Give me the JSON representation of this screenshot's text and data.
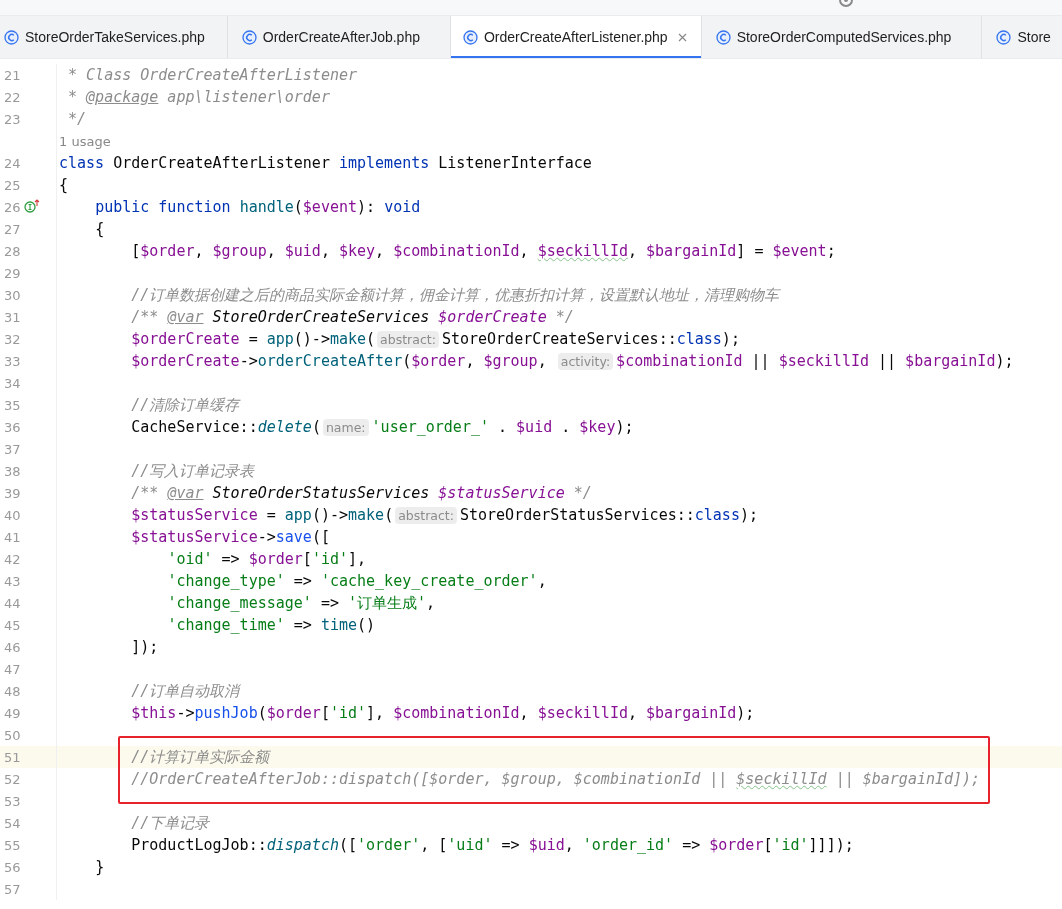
{
  "tabs": [
    {
      "label": "StoreOrderTakeServices.php",
      "selected": false
    },
    {
      "label": "OrderCreateAfterJob.php",
      "selected": false
    },
    {
      "label": "OrderCreateAfterListener.php",
      "selected": true
    },
    {
      "label": "StoreOrderComputedServices.php",
      "selected": false
    },
    {
      "label": "Store",
      "selected": false
    }
  ],
  "lines": [
    {
      "kind": "code",
      "number": "21",
      "current": false,
      "boxed": false,
      "tokens": [
        {
          "t": " * Class OrderCreateAfterListener",
          "kind": "doc"
        }
      ]
    },
    {
      "kind": "code",
      "number": "22",
      "current": false,
      "boxed": false,
      "tokens": [
        {
          "t": " * ",
          "kind": "doc"
        },
        {
          "t": "@package",
          "kind": "doctag"
        },
        {
          "t": " app\\listener\\order",
          "kind": "doc"
        }
      ]
    },
    {
      "kind": "code",
      "number": "23",
      "current": false,
      "boxed": false,
      "tokens": [
        {
          "t": " */",
          "kind": "doc"
        }
      ]
    },
    {
      "kind": "usage",
      "text": "1 usage",
      "current": false,
      "boxed": false
    },
    {
      "kind": "code",
      "number": "24",
      "current": false,
      "boxed": false,
      "tokens": [
        {
          "t": "class",
          "kind": "kw"
        },
        {
          "t": " OrderCreateAfterListener ",
          "kind": "plain"
        },
        {
          "t": "implements",
          "kind": "kw"
        },
        {
          "t": " ListenerInterface",
          "kind": "plain"
        }
      ]
    },
    {
      "kind": "code",
      "number": "25",
      "current": false,
      "boxed": false,
      "tokens": [
        {
          "t": "{",
          "kind": "plain"
        }
      ]
    },
    {
      "kind": "code",
      "number": "26",
      "current": false,
      "boxed": false,
      "gutter_mark": {
        "kind": "implements"
      },
      "tokens": [
        {
          "t": "    public function ",
          "kind": "kw"
        },
        {
          "t": "handle",
          "kind": "fn"
        },
        {
          "t": "(",
          "kind": "plain"
        },
        {
          "t": "$event",
          "kind": "var"
        },
        {
          "t": "): ",
          "kind": "plain"
        },
        {
          "t": "void",
          "kind": "kw"
        }
      ]
    },
    {
      "kind": "code",
      "number": "27",
      "current": false,
      "boxed": false,
      "tokens": [
        {
          "t": "    {",
          "kind": "plain"
        }
      ]
    },
    {
      "kind": "code",
      "number": "28",
      "current": false,
      "boxed": false,
      "tokens": [
        {
          "t": "        [",
          "kind": "plain"
        },
        {
          "t": "$order",
          "kind": "var"
        },
        {
          "t": ", ",
          "kind": "plain"
        },
        {
          "t": "$group",
          "kind": "var"
        },
        {
          "t": ", ",
          "kind": "plain"
        },
        {
          "t": "$uid",
          "kind": "var"
        },
        {
          "t": ", ",
          "kind": "plain"
        },
        {
          "t": "$key",
          "kind": "var"
        },
        {
          "t": ", ",
          "kind": "plain"
        },
        {
          "t": "$combinationId",
          "kind": "var"
        },
        {
          "t": ", ",
          "kind": "plain"
        },
        {
          "t": "$seckillId",
          "kind": "vartypo"
        },
        {
          "t": ", ",
          "kind": "plain"
        },
        {
          "t": "$bargainId",
          "kind": "var"
        },
        {
          "t": "] = ",
          "kind": "plain"
        },
        {
          "t": "$event",
          "kind": "var"
        },
        {
          "t": ";",
          "kind": "plain"
        }
      ]
    },
    {
      "kind": "code",
      "number": "29",
      "current": false,
      "boxed": false
    },
    {
      "kind": "code",
      "number": "30",
      "current": false,
      "boxed": false,
      "tokens": [
        {
          "t": "        //订单数据创建之后的商品实际金额计算，佣金计算，优惠折扣计算，设置默认地址，清理购物车",
          "kind": "cmt"
        }
      ]
    },
    {
      "kind": "code",
      "number": "31",
      "current": false,
      "boxed": false,
      "tokens": [
        {
          "t": "        /** ",
          "kind": "doc"
        },
        {
          "t": "@var",
          "kind": "doctag"
        },
        {
          "t": " StoreOrderCreateServices ",
          "kind": "doctype"
        },
        {
          "t": "$orderCreate",
          "kind": "docvar"
        },
        {
          "t": " */",
          "kind": "doc"
        }
      ]
    },
    {
      "kind": "code",
      "number": "32",
      "current": false,
      "boxed": false,
      "tokens": [
        {
          "t": "        $orderCreate",
          "kind": "var"
        },
        {
          "t": " = ",
          "kind": "plain"
        },
        {
          "t": "app",
          "kind": "fn"
        },
        {
          "t": "()->",
          "kind": "plain"
        },
        {
          "t": "make",
          "kind": "fn"
        },
        {
          "t": "(",
          "kind": "plain"
        },
        {
          "t": "abstract:",
          "kind": "hint"
        },
        {
          "t": "StoreOrderCreateServices::",
          "kind": "plain"
        },
        {
          "t": "class",
          "kind": "kw"
        },
        {
          "t": ");",
          "kind": "plain"
        }
      ]
    },
    {
      "kind": "code",
      "number": "33",
      "current": false,
      "boxed": false,
      "tokens": [
        {
          "t": "        $orderCreate",
          "kind": "var"
        },
        {
          "t": "->",
          "kind": "plain"
        },
        {
          "t": "orderCreateAfter",
          "kind": "fn"
        },
        {
          "t": "(",
          "kind": "plain"
        },
        {
          "t": "$order",
          "kind": "var"
        },
        {
          "t": ", ",
          "kind": "plain"
        },
        {
          "t": "$group",
          "kind": "var"
        },
        {
          "t": ", ",
          "kind": "plain"
        },
        {
          "t": "activity:",
          "kind": "hint"
        },
        {
          "t": "$combinationId",
          "kind": "var"
        },
        {
          "t": " || ",
          "kind": "plain"
        },
        {
          "t": "$seckillId",
          "kind": "var"
        },
        {
          "t": " || ",
          "kind": "plain"
        },
        {
          "t": "$bargainId",
          "kind": "var"
        },
        {
          "t": ");",
          "kind": "plain"
        }
      ]
    },
    {
      "kind": "code",
      "number": "34",
      "current": false,
      "boxed": false
    },
    {
      "kind": "code",
      "number": "35",
      "current": false,
      "boxed": false,
      "tokens": [
        {
          "t": "        //清除订单缓存",
          "kind": "cmt"
        }
      ]
    },
    {
      "kind": "code",
      "number": "36",
      "current": false,
      "boxed": false,
      "tokens": [
        {
          "t": "        CacheService::",
          "kind": "plain"
        },
        {
          "t": "delete",
          "kind": "fni"
        },
        {
          "t": "(",
          "kind": "plain"
        },
        {
          "t": "name:",
          "kind": "hint"
        },
        {
          "t": "'user_order_'",
          "kind": "str"
        },
        {
          "t": " . ",
          "kind": "plain"
        },
        {
          "t": "$uid",
          "kind": "var"
        },
        {
          "t": " . ",
          "kind": "plain"
        },
        {
          "t": "$key",
          "kind": "var"
        },
        {
          "t": ");",
          "kind": "plain"
        }
      ]
    },
    {
      "kind": "code",
      "number": "37",
      "current": false,
      "boxed": false
    },
    {
      "kind": "code",
      "number": "38",
      "current": false,
      "boxed": false,
      "tokens": [
        {
          "t": "        //写入订单记录表",
          "kind": "cmt"
        }
      ]
    },
    {
      "kind": "code",
      "number": "39",
      "current": false,
      "boxed": false,
      "tokens": [
        {
          "t": "        /** ",
          "kind": "doc"
        },
        {
          "t": "@var",
          "kind": "doctag"
        },
        {
          "t": " StoreOrderStatusServices ",
          "kind": "doctype"
        },
        {
          "t": "$statusService",
          "kind": "docvar"
        },
        {
          "t": " */",
          "kind": "doc"
        }
      ]
    },
    {
      "kind": "code",
      "number": "40",
      "current": false,
      "boxed": false,
      "tokens": [
        {
          "t": "        $statusService",
          "kind": "var"
        },
        {
          "t": " = ",
          "kind": "plain"
        },
        {
          "t": "app",
          "kind": "fn"
        },
        {
          "t": "()->",
          "kind": "plain"
        },
        {
          "t": "make",
          "kind": "fn"
        },
        {
          "t": "(",
          "kind": "plain"
        },
        {
          "t": "abstract:",
          "kind": "hint"
        },
        {
          "t": "StoreOrderStatusServices::",
          "kind": "plain"
        },
        {
          "t": "class",
          "kind": "kw"
        },
        {
          "t": ");",
          "kind": "plain"
        }
      ]
    },
    {
      "kind": "code",
      "number": "41",
      "current": false,
      "boxed": false,
      "tokens": [
        {
          "t": "        $statusService",
          "kind": "var"
        },
        {
          "t": "->",
          "kind": "plain"
        },
        {
          "t": "save",
          "kind": "method"
        },
        {
          "t": "([",
          "kind": "plain"
        }
      ]
    },
    {
      "kind": "code",
      "number": "42",
      "current": false,
      "boxed": false,
      "tokens": [
        {
          "t": "            'oid'",
          "kind": "str"
        },
        {
          "t": " => ",
          "kind": "plain"
        },
        {
          "t": "$order",
          "kind": "var"
        },
        {
          "t": "[",
          "kind": "plain"
        },
        {
          "t": "'id'",
          "kind": "str"
        },
        {
          "t": "],",
          "kind": "plain"
        }
      ]
    },
    {
      "kind": "code",
      "number": "43",
      "current": false,
      "boxed": false,
      "tokens": [
        {
          "t": "            'change_type'",
          "kind": "str"
        },
        {
          "t": " => ",
          "kind": "plain"
        },
        {
          "t": "'cache_key_create_order'",
          "kind": "str"
        },
        {
          "t": ",",
          "kind": "plain"
        }
      ]
    },
    {
      "kind": "code",
      "number": "44",
      "current": false,
      "boxed": false,
      "tokens": [
        {
          "t": "            'change_message'",
          "kind": "str"
        },
        {
          "t": " => ",
          "kind": "plain"
        },
        {
          "t": "'订单生成'",
          "kind": "str"
        },
        {
          "t": ",",
          "kind": "plain"
        }
      ]
    },
    {
      "kind": "code",
      "number": "45",
      "current": false,
      "boxed": false,
      "tokens": [
        {
          "t": "            'change_time'",
          "kind": "str"
        },
        {
          "t": " => ",
          "kind": "plain"
        },
        {
          "t": "time",
          "kind": "fn"
        },
        {
          "t": "()",
          "kind": "plain"
        }
      ]
    },
    {
      "kind": "code",
      "number": "46",
      "current": false,
      "boxed": false,
      "tokens": [
        {
          "t": "        ]);",
          "kind": "plain"
        }
      ]
    },
    {
      "kind": "code",
      "number": "47",
      "current": false,
      "boxed": false
    },
    {
      "kind": "code",
      "number": "48",
      "current": false,
      "boxed": false,
      "tokens": [
        {
          "t": "        //订单自动取消",
          "kind": "cmt"
        }
      ]
    },
    {
      "kind": "code",
      "number": "49",
      "current": false,
      "boxed": false,
      "tokens": [
        {
          "t": "        $this",
          "kind": "var"
        },
        {
          "t": "->",
          "kind": "plain"
        },
        {
          "t": "pushJob",
          "kind": "method"
        },
        {
          "t": "(",
          "kind": "plain"
        },
        {
          "t": "$order",
          "kind": "var"
        },
        {
          "t": "[",
          "kind": "plain"
        },
        {
          "t": "'id'",
          "kind": "str"
        },
        {
          "t": "], ",
          "kind": "plain"
        },
        {
          "t": "$combinationId",
          "kind": "var"
        },
        {
          "t": ", ",
          "kind": "plain"
        },
        {
          "t": "$seckillId",
          "kind": "var"
        },
        {
          "t": ", ",
          "kind": "plain"
        },
        {
          "t": "$bargainId",
          "kind": "var"
        },
        {
          "t": ");",
          "kind": "plain"
        }
      ]
    },
    {
      "kind": "code",
      "number": "50",
      "current": false,
      "boxed": false
    },
    {
      "kind": "code",
      "number": "51",
      "current": true,
      "boxed": true,
      "tokens": [
        {
          "t": "        //计算订单实际金额",
          "kind": "cmt"
        }
      ]
    },
    {
      "kind": "code",
      "number": "52",
      "current": false,
      "boxed": true,
      "tokens": [
        {
          "t": "        //OrderCreateAfterJob::dispatch([$order, $group, $combinationId || ",
          "kind": "cmt"
        },
        {
          "t": "$seckillId",
          "kind": "cmttypo"
        },
        {
          "t": " || $bargainId]);",
          "kind": "cmt"
        }
      ]
    },
    {
      "kind": "code",
      "number": "53",
      "current": false,
      "boxed": false
    },
    {
      "kind": "code",
      "number": "54",
      "current": false,
      "boxed": false,
      "tokens": [
        {
          "t": "        //下单记录",
          "kind": "cmt"
        }
      ]
    },
    {
      "kind": "code",
      "number": "55",
      "current": false,
      "boxed": false,
      "tokens": [
        {
          "t": "        ProductLogJob::",
          "kind": "plain"
        },
        {
          "t": "dispatch",
          "kind": "fni"
        },
        {
          "t": "([",
          "kind": "plain"
        },
        {
          "t": "'order'",
          "kind": "str"
        },
        {
          "t": ", [",
          "kind": "plain"
        },
        {
          "t": "'uid'",
          "kind": "str"
        },
        {
          "t": " => ",
          "kind": "plain"
        },
        {
          "t": "$uid",
          "kind": "var"
        },
        {
          "t": ", ",
          "kind": "plain"
        },
        {
          "t": "'order_id'",
          "kind": "str"
        },
        {
          "t": " => ",
          "kind": "plain"
        },
        {
          "t": "$order",
          "kind": "var"
        },
        {
          "t": "[",
          "kind": "plain"
        },
        {
          "t": "'id'",
          "kind": "str"
        },
        {
          "t": "]]]);",
          "kind": "plain"
        }
      ]
    },
    {
      "kind": "code",
      "number": "56",
      "current": false,
      "boxed": false,
      "tokens": [
        {
          "t": "    }",
          "kind": "plain"
        }
      ]
    },
    {
      "kind": "code",
      "number": "57",
      "current": false,
      "boxed": false
    }
  ]
}
